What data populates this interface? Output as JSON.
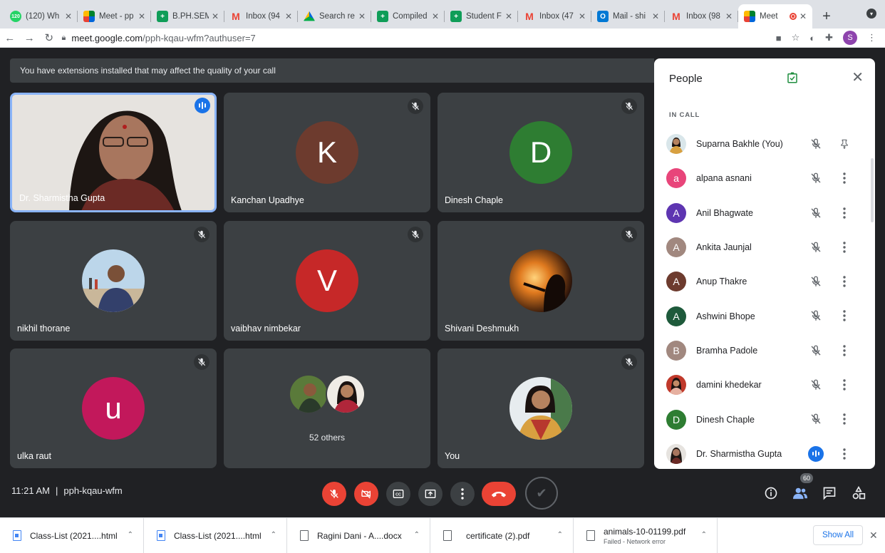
{
  "browser": {
    "tabs": [
      {
        "title": "(120) Wh",
        "favicon": "whatsapp-icon",
        "badge": "120"
      },
      {
        "title": "Meet - pp",
        "favicon": "meet-icon"
      },
      {
        "title": "B.PH.SEM",
        "favicon": "sheets-icon"
      },
      {
        "title": "Inbox (94",
        "favicon": "gmail-icon"
      },
      {
        "title": "Search re",
        "favicon": "drive-icon"
      },
      {
        "title": "Compiled",
        "favicon": "sheets-icon"
      },
      {
        "title": "Student F",
        "favicon": "sheets-icon"
      },
      {
        "title": "Inbox (47",
        "favicon": "gmail-icon"
      },
      {
        "title": "Mail - shi",
        "favicon": "outlook-icon"
      },
      {
        "title": "Inbox (98",
        "favicon": "gmail-icon"
      },
      {
        "title": "Meet",
        "favicon": "meet-icon",
        "active": true,
        "recording": true
      }
    ],
    "url_host": "meet.google.com",
    "url_path": "/pph-kqau-wfm?authuser=7",
    "profile_initial": "S"
  },
  "meet": {
    "banner": "You have extensions installed that may affect the quality of your call",
    "tiles": [
      {
        "name": "Dr. Sharmistha Gupta",
        "kind": "video",
        "speaking": true
      },
      {
        "name": "Kanchan Upadhye",
        "kind": "initial",
        "initial": "K",
        "color": "#6d3b2e",
        "muted": true
      },
      {
        "name": "Dinesh Chaple",
        "kind": "initial",
        "initial": "D",
        "color": "#2e7d32",
        "muted": true
      },
      {
        "name": "nikhil thorane",
        "kind": "photo",
        "muted": true
      },
      {
        "name": "vaibhav nimbekar",
        "kind": "initial",
        "initial": "V",
        "color": "#c62828",
        "muted": true
      },
      {
        "name": "Shivani Deshmukh",
        "kind": "photo",
        "muted": true
      },
      {
        "name": "ulka raut",
        "kind": "initial",
        "initial": "u",
        "color": "#c2185b",
        "muted": true
      },
      {
        "name": "52 others",
        "kind": "others"
      },
      {
        "name": "You",
        "kind": "photo",
        "muted": true
      }
    ],
    "time": "11:21 AM",
    "separator": "|",
    "meeting_code": "pph-kqau-wfm",
    "participant_count": "60"
  },
  "people_panel": {
    "title": "People",
    "section": "IN CALL",
    "participants": [
      {
        "name": "Suparna Bakhle (You)",
        "kind": "photo",
        "action": "pin"
      },
      {
        "name": "alpana asnani",
        "initial": "a",
        "color": "#e8457a"
      },
      {
        "name": "Anil Bhagwate",
        "initial": "A",
        "color": "#5e35b1"
      },
      {
        "name": "Ankita Jaunjal",
        "initial": "A",
        "color": "#a1887f"
      },
      {
        "name": "Anup Thakre",
        "initial": "A",
        "color": "#6d3b2e"
      },
      {
        "name": "Ashwini Bhope",
        "initial": "A",
        "color": "#1e5a3b"
      },
      {
        "name": "Bramha Padole",
        "initial": "B",
        "color": "#a1887f"
      },
      {
        "name": "damini khedekar",
        "kind": "photo"
      },
      {
        "name": "Dinesh Chaple",
        "initial": "D",
        "color": "#2e7d32"
      },
      {
        "name": "Dr. Sharmistha Gupta",
        "kind": "photo",
        "speaking": true
      }
    ]
  },
  "downloads": {
    "items": [
      {
        "name": "Class-List (2021....html",
        "icon": "blue"
      },
      {
        "name": "Class-List (2021....html",
        "icon": "blue"
      },
      {
        "name": "Ragini Dani - A....docx",
        "icon": "gray"
      },
      {
        "name": "certificate (2).pdf",
        "icon": "gray"
      },
      {
        "name": "animals-10-01199.pdf",
        "status": "Failed - Network error",
        "icon": "gray"
      }
    ],
    "show_all": "Show All"
  }
}
